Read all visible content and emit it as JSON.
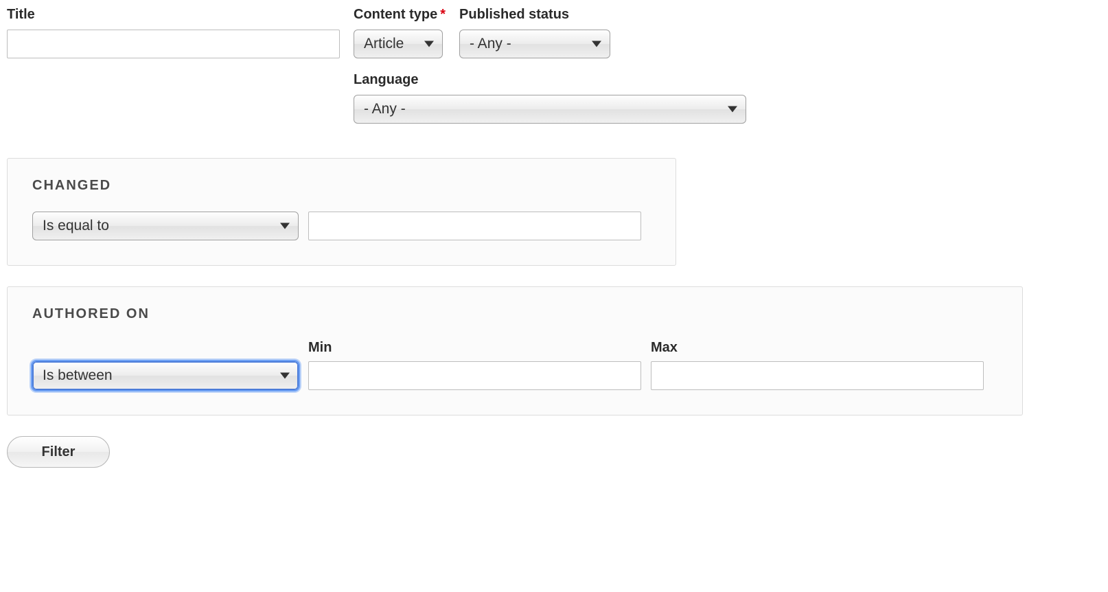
{
  "filters": {
    "title": {
      "label": "Title",
      "value": ""
    },
    "content_type": {
      "label": "Content type",
      "selected": "Article",
      "required": true
    },
    "published_status": {
      "label": "Published status",
      "selected": "- Any -"
    },
    "language": {
      "label": "Language",
      "selected": "- Any -"
    }
  },
  "changed": {
    "legend": "Changed",
    "operator": "Is equal to",
    "value": ""
  },
  "authored_on": {
    "legend": "Authored on",
    "operator": "Is between",
    "min_label": "Min",
    "max_label": "Max",
    "min_value": "",
    "max_value": ""
  },
  "submit_label": "Filter",
  "required_marker": "*"
}
